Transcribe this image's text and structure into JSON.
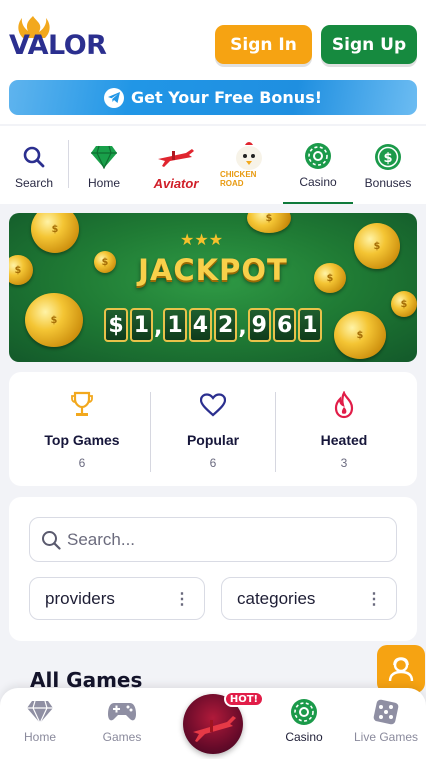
{
  "header": {
    "logo_text": "VALOR",
    "signin_label": "Sign In",
    "signup_label": "Sign Up",
    "bonus_label": "Get Your Free Bonus!"
  },
  "catnav": {
    "search_label": "Search",
    "home_label": "Home",
    "aviator_label": "Aviator",
    "chicken_label": "CHICKEN ROAD",
    "casino_label": "Casino",
    "bonuses_label": "Bonuses",
    "active": "Casino"
  },
  "jackpot": {
    "title": "JACKPOT",
    "currency": "$",
    "amount": "1,142,961"
  },
  "tabs": [
    {
      "title": "Top Games",
      "count": "6",
      "icon": "trophy-icon"
    },
    {
      "title": "Popular",
      "count": "6",
      "icon": "heart-icon"
    },
    {
      "title": "Heated",
      "count": "3",
      "icon": "flame-icon"
    }
  ],
  "filters": {
    "search_placeholder": "Search...",
    "providers_label": "providers",
    "categories_label": "categories"
  },
  "section_title": "All Games",
  "bottomnav": {
    "home_label": "Home",
    "games_label": "Games",
    "hot_badge": "HOT!",
    "casino_label": "Casino",
    "live_label": "Live Games"
  },
  "colors": {
    "accent_orange": "#f6a312",
    "accent_green": "#168a3f",
    "brand_navy": "#2b2f8f",
    "hot_red": "#e11d48"
  }
}
